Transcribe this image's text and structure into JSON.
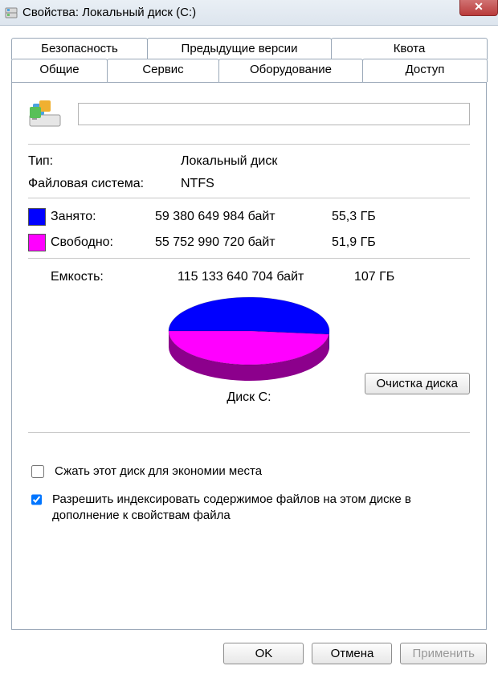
{
  "window": {
    "title": "Свойства: Локальный диск (C:)",
    "close_glyph": "✕"
  },
  "tabs_top": [
    {
      "label": "Безопасность"
    },
    {
      "label": "Предыдущие версии"
    },
    {
      "label": "Квота"
    }
  ],
  "tabs_bottom": [
    {
      "label": "Общие",
      "active": true
    },
    {
      "label": "Сервис"
    },
    {
      "label": "Оборудование"
    },
    {
      "label": "Доступ"
    }
  ],
  "general": {
    "name_value": "",
    "type_label": "Тип:",
    "type_value": "Локальный диск",
    "fs_label": "Файловая система:",
    "fs_value": "NTFS",
    "used_label": "Занято:",
    "used_bytes": "59 380 649 984 байт",
    "used_pretty": "55,3 ГБ",
    "used_color": "#0000ff",
    "free_label": "Свободно:",
    "free_bytes": "55 752 990 720 байт",
    "free_pretty": "51,9 ГБ",
    "free_color": "#ff00ff",
    "cap_label": "Емкость:",
    "cap_bytes": "115 133 640 704 байт",
    "cap_pretty": "107 ГБ",
    "disk_caption": "Диск C:",
    "cleanup_btn": "Очистка диска",
    "compress_label": "Сжать этот диск для экономии места",
    "compress_checked": false,
    "index_label": "Разрешить индексировать содержимое файлов на этом диске в дополнение к свойствам файла",
    "index_checked": true
  },
  "buttons": {
    "ok": "OK",
    "cancel": "Отмена",
    "apply": "Применить"
  },
  "chart_data": {
    "type": "pie",
    "title": "Диск C:",
    "series": [
      {
        "name": "Занято",
        "value": 59380649984,
        "color": "#0000ff"
      },
      {
        "name": "Свободно",
        "value": 55752990720,
        "color": "#ff00ff"
      }
    ]
  }
}
